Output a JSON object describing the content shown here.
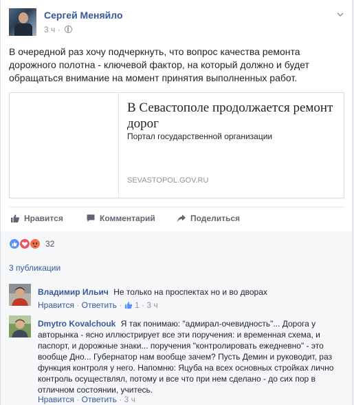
{
  "post": {
    "author": "Сергей Меняйло",
    "time": "3 ч",
    "text": "В очередной раз хочу подчеркнуть, что вопрос качества ремонта дорожного полотна - ключевой фактор, на который должно и будет обращаться внимание на момент принятия выполненных работ."
  },
  "link": {
    "title": "В Севастополе продолжается ремонт дорог",
    "description": "Портал государственной организации",
    "domain": "SEVASTOPOL.GOV.RU"
  },
  "actions": {
    "like": "Нравится",
    "comment": "Комментарий",
    "share": "Поделиться"
  },
  "reactions": {
    "count": "32",
    "icons": [
      "like-icon",
      "love-icon",
      "angry-icon"
    ],
    "colors": {
      "like": "#5890ff",
      "love": "#f25268",
      "angry": "#f7714c"
    }
  },
  "shares": {
    "label": "3 публикации"
  },
  "comments": [
    {
      "name": "Владимир Ильич",
      "text": "Не только на проспектах но и во дворах",
      "like_label": "Нравится",
      "reply_label": "Ответить",
      "likes": "1",
      "time": "3 ч"
    },
    {
      "name": "Dmytro Kovalchouk",
      "text": "Я так понимаю: \"адмирал-очевидность\"... Дорога у авторынка - ясно иллюстрирует все эти поручения: и временная схема, и паспорт, и дорожные знаки... поручения \"контролировать ежедневно\" - это вообще Дно... Губернатор нам вообще зачем? Пусть Демин и руководит, раз функция контроля у него. Напомню: Яцуба на всех основных стройках лично контроль осуществлял, потому и все что при нем сделано - до сих пор в отличном состоянии, учитесь.",
      "like_label": "Нравится",
      "reply_label": "Ответить",
      "time": "3 ч"
    }
  ]
}
